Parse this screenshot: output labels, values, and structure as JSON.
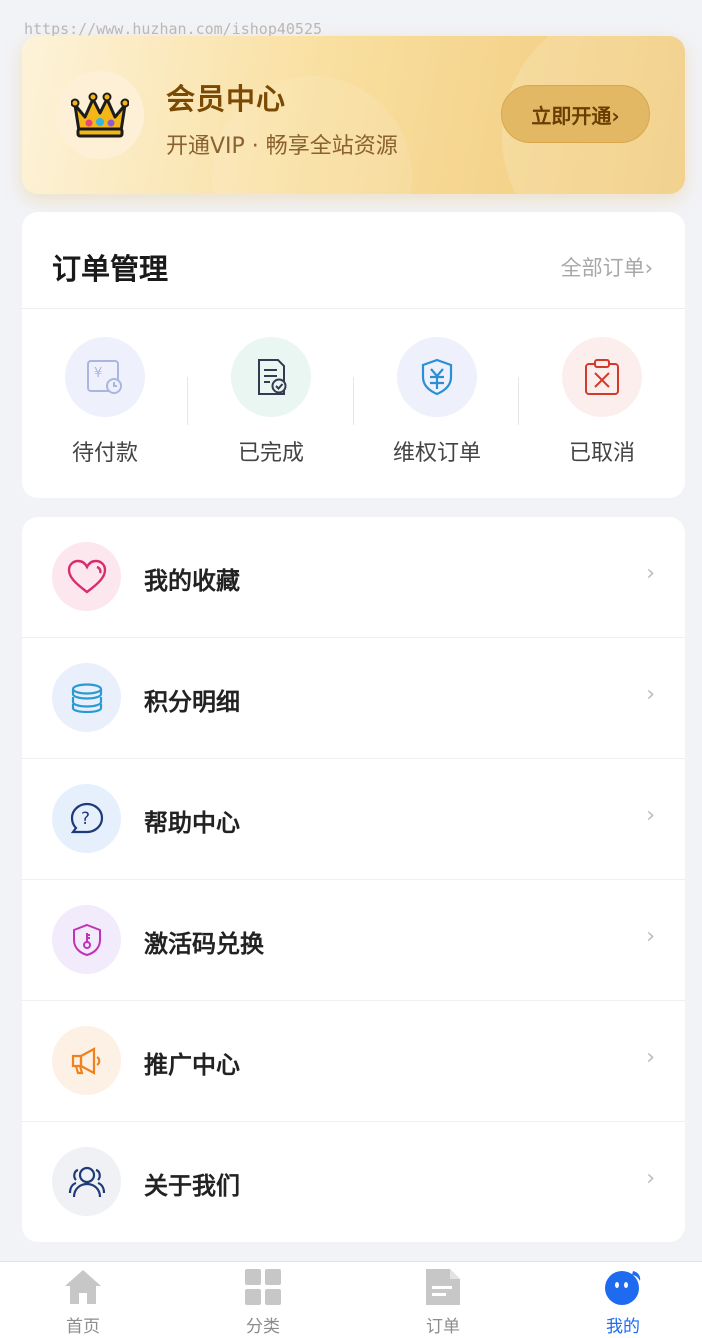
{
  "watermark": "https://www.huzhan.com/ishop40525",
  "vip": {
    "title": "会员中心",
    "subtitle": "开通VIP · 畅享全站资源",
    "button": "立即开通›"
  },
  "orders": {
    "title": "订单管理",
    "all_link": "全部订单›",
    "items": [
      {
        "label": "待付款",
        "icon": "pending-payment-icon",
        "bg": "#eef1fb"
      },
      {
        "label": "已完成",
        "icon": "completed-icon",
        "bg": "#eaf6f1"
      },
      {
        "label": "维权订单",
        "icon": "rights-order-icon",
        "bg": "#eef1fb"
      },
      {
        "label": "已取消",
        "icon": "cancelled-icon",
        "bg": "#fdeeee"
      }
    ]
  },
  "menu": [
    {
      "label": "我的收藏",
      "arrow": "›",
      "icon": "heart-icon",
      "bg": "#fde7ee"
    },
    {
      "label": "积分明细",
      "arrow": "›",
      "icon": "coins-icon",
      "bg": "#eaf0fb"
    },
    {
      "label": "帮助中心",
      "arrow": "›",
      "icon": "help-icon",
      "bg": "#e6f0fd"
    },
    {
      "label": "激活码兑换",
      "arrow": "›",
      "icon": "key-shield-icon",
      "bg": "#f2ebfb"
    },
    {
      "label": "推广中心",
      "arrow": "›",
      "icon": "megaphone-icon",
      "bg": "#fdf0e4"
    },
    {
      "label": "关于我们",
      "arrow": "›",
      "icon": "users-icon",
      "bg": "#eff1f4"
    }
  ],
  "tabs": [
    {
      "label": "首页",
      "icon": "home-icon"
    },
    {
      "label": "分类",
      "icon": "grid-icon"
    },
    {
      "label": "订单",
      "icon": "document-icon"
    },
    {
      "label": "我的",
      "icon": "profile-face-icon",
      "active": true
    }
  ],
  "colors": {
    "accent": "#1e6bf0",
    "vip_gold": "#e2b864",
    "inactive_tab": "#8c8c8c"
  }
}
